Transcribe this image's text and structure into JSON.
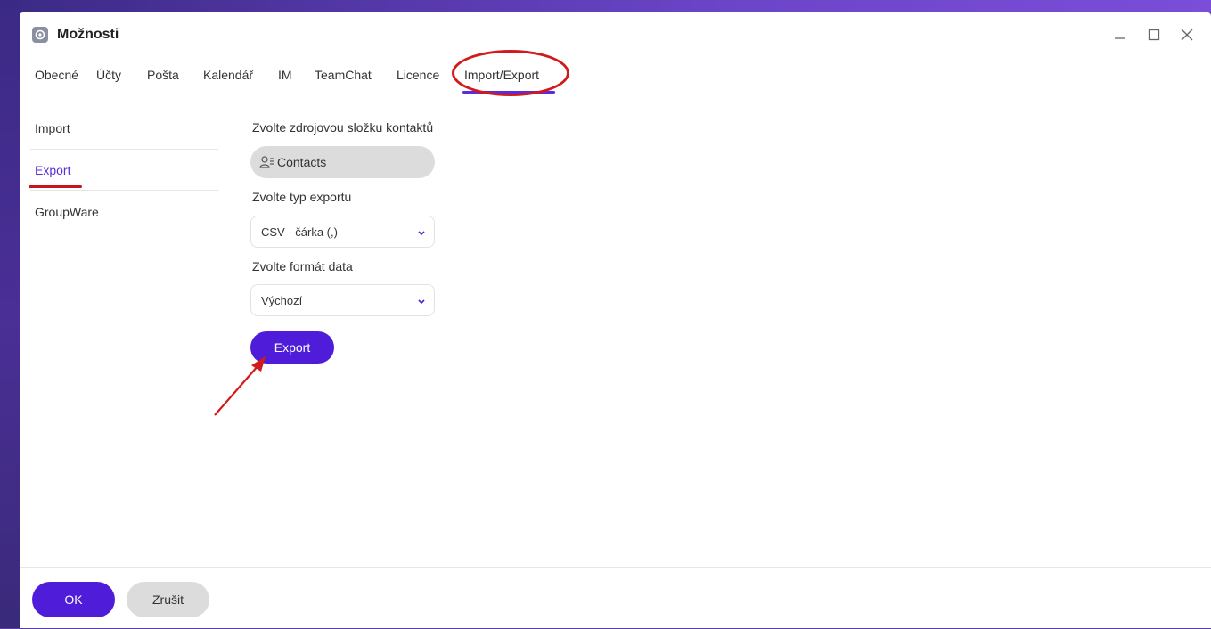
{
  "window": {
    "title": "Možnosti",
    "icon": "app-logo-icon"
  },
  "tabs": [
    {
      "label": "Obecné"
    },
    {
      "label": "Účty"
    },
    {
      "label": "Pošta"
    },
    {
      "label": "Kalendář"
    },
    {
      "label": "IM"
    },
    {
      "label": "TeamChat"
    },
    {
      "label": "Licence"
    },
    {
      "label": "Import/Export",
      "active": true
    }
  ],
  "sidebar": {
    "items": [
      {
        "label": "Import"
      },
      {
        "label": "Export",
        "active": true
      },
      {
        "label": "GroupWare"
      }
    ]
  },
  "main": {
    "source_label": "Zvolte zdrojovou složku kontaktů",
    "source_value": "Contacts",
    "export_type_label": "Zvolte typ exportu",
    "export_type_value": "CSV - čárka (,)",
    "date_format_label": "Zvolte formát data",
    "date_format_value": "Výchozí",
    "export_button": "Export"
  },
  "footer": {
    "ok": "OK",
    "cancel": "Zrušit"
  },
  "colors": {
    "accent": "#4f1dd9",
    "annotation": "#d11a1a"
  }
}
